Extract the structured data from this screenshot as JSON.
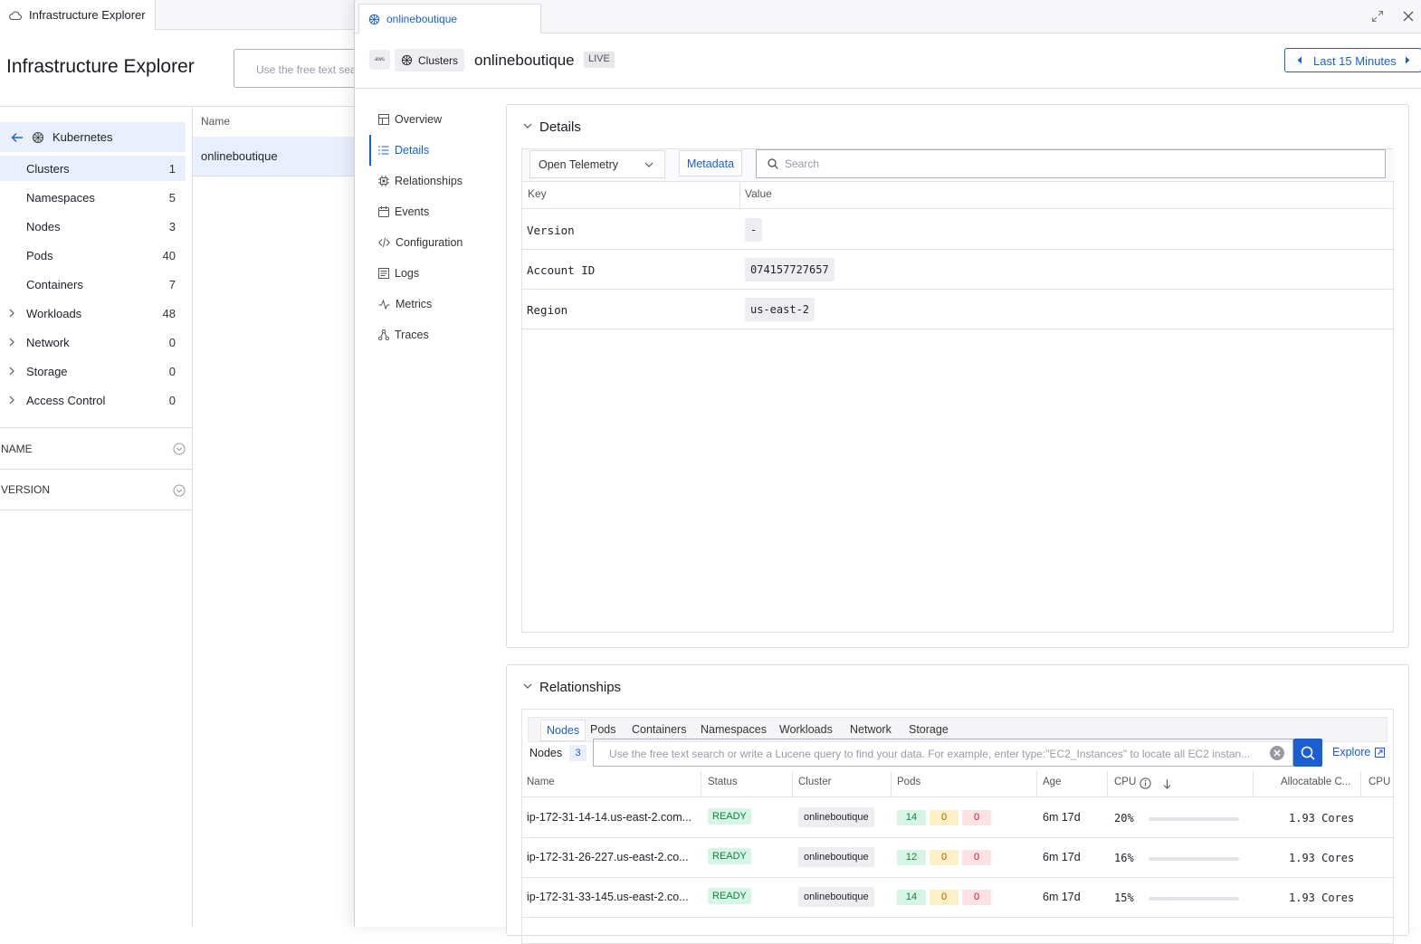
{
  "app": {
    "tab_title": "Infrastructure Explorer",
    "page_title": "Infrastructure Explorer",
    "search_placeholder": "Use the free text sea"
  },
  "sidebar": {
    "back_label": "Kubernetes",
    "items": [
      {
        "label": "Clusters",
        "count": "1"
      },
      {
        "label": "Namespaces",
        "count": "5"
      },
      {
        "label": "Nodes",
        "count": "3"
      },
      {
        "label": "Pods",
        "count": "40"
      },
      {
        "label": "Containers",
        "count": "7"
      },
      {
        "label": "Workloads",
        "count": "48"
      },
      {
        "label": "Network",
        "count": "0"
      },
      {
        "label": "Storage",
        "count": "0"
      },
      {
        "label": "Access Control",
        "count": "0"
      }
    ],
    "facets": [
      "NAME",
      "VERSION"
    ]
  },
  "list": {
    "column": "Name",
    "rows": [
      "onlineboutique"
    ]
  },
  "drawer": {
    "tab_label": "onlineboutique",
    "provider_badge": "aws",
    "type_chip": "Clusters",
    "title": "onlineboutique",
    "live_badge": "LIVE",
    "time_range": "Last 15 Minutes",
    "nav": [
      "Overview",
      "Details",
      "Relationships",
      "Events",
      "Configuration",
      "Logs",
      "Metrics",
      "Traces"
    ],
    "nav_active": "Details"
  },
  "details": {
    "title": "Details",
    "source": "Open Telemetry",
    "metadata_button": "Metadata",
    "search_placeholder": "Search",
    "columns": {
      "key": "Key",
      "value": "Value"
    },
    "rows": [
      {
        "key": "Version",
        "value": "-"
      },
      {
        "key": "Account ID",
        "value": "074157727657"
      },
      {
        "key": "Region",
        "value": "us-east-2"
      }
    ]
  },
  "relationships": {
    "title": "Relationships",
    "tabs": [
      "Nodes",
      "Pods",
      "Containers",
      "Namespaces",
      "Workloads",
      "Network",
      "Storage"
    ],
    "active_tab": "Nodes",
    "entity_label": "Nodes",
    "entity_count": "3",
    "query_placeholder": "Use the free text search or write a Lucene query to find your data. For example, enter type:\"EC2_Instances\" to locate all EC2 instan...",
    "explore_label": "Explore",
    "columns": [
      "Name",
      "Status",
      "Cluster",
      "Pods",
      "Age",
      "CPU",
      "Allocatable C...",
      "CPU"
    ],
    "rows": [
      {
        "name": "ip-172-31-14-14.us-east-2.com...",
        "status": "READY",
        "cluster": "onlineboutique",
        "pods": [
          "14",
          "0",
          "0"
        ],
        "age": "6m 17d",
        "cpu": "20%",
        "cpu_fraction": 0.2,
        "alloc": "1.93 Cores"
      },
      {
        "name": "ip-172-31-26-227.us-east-2.co...",
        "status": "READY",
        "cluster": "onlineboutique",
        "pods": [
          "12",
          "0",
          "0"
        ],
        "age": "6m 17d",
        "cpu": "16%",
        "cpu_fraction": 0.16,
        "alloc": "1.93 Cores"
      },
      {
        "name": "ip-172-31-33-145.us-east-2.co...",
        "status": "READY",
        "cluster": "onlineboutique",
        "pods": [
          "14",
          "0",
          "0"
        ],
        "age": "6m 17d",
        "cpu": "15%",
        "cpu_fraction": 0.15,
        "alloc": "1.93 Cores"
      }
    ]
  }
}
